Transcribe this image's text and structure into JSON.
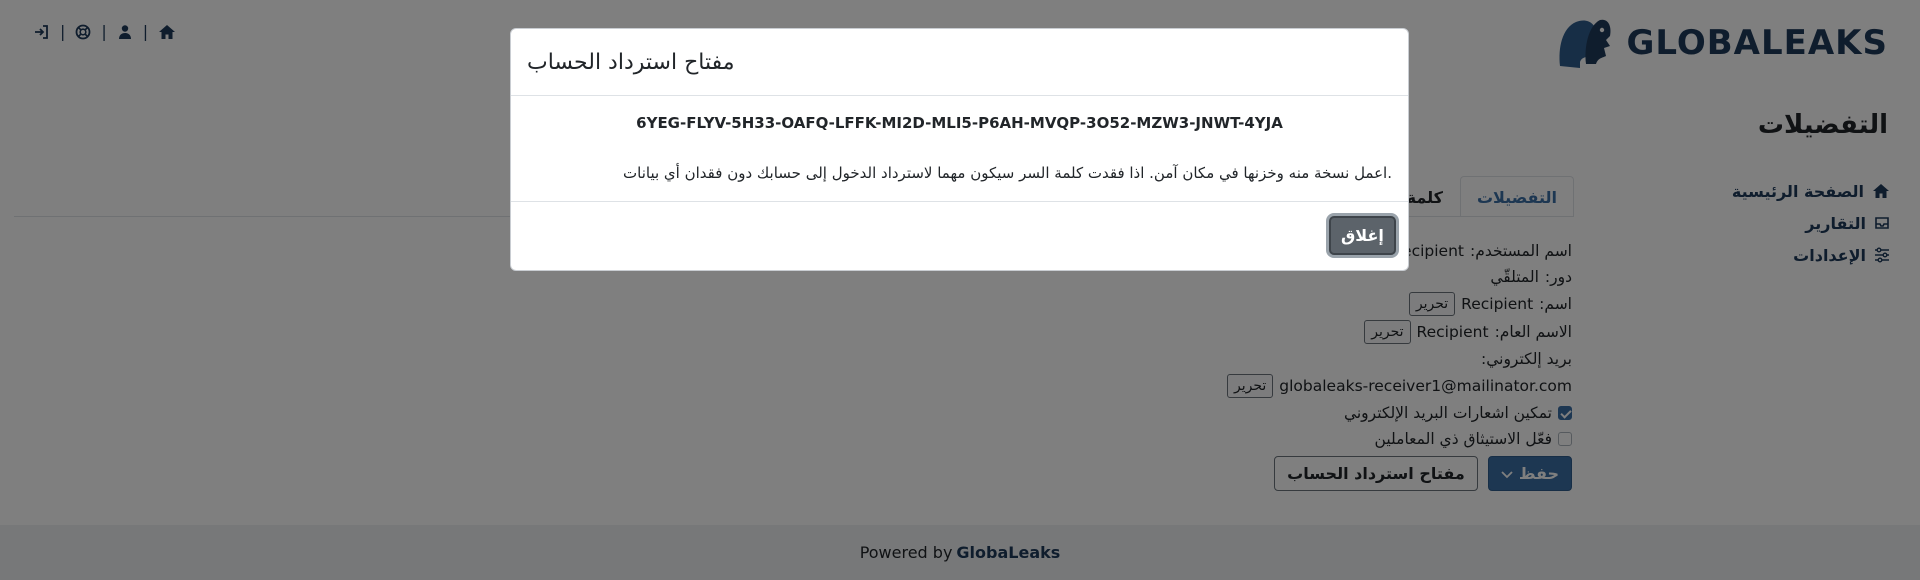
{
  "brand": {
    "name": "GLOBALEAKS"
  },
  "page": {
    "title": "التفضيلات"
  },
  "nav": [
    {
      "label": "الصفحة الرئيسية",
      "icon": "home-icon"
    },
    {
      "label": "التقارير",
      "icon": "inbox-icon"
    },
    {
      "label": "الإعدادات",
      "icon": "sliders-icon"
    }
  ],
  "tabs": [
    {
      "label": "التفضيلات",
      "active": true
    },
    {
      "label": "كلمة ا",
      "active": false
    }
  ],
  "details": {
    "username_label": "اسم المستخدم:",
    "username_value": "Recipient",
    "role_label": "دور:",
    "role_value": "المتلقّي",
    "name_label": "اسم:",
    "name_value": "Recipient",
    "public_name_label": "الاسم العام:",
    "public_name_value": "Recipient",
    "email_label": "بريد إلكتروني:",
    "email_value": "globaleaks-receiver1@mailinator.com",
    "edit_label": "تحرير",
    "email_notifications_label": "تمكين اشعارات البريد الإلكتروني",
    "email_notifications_checked": true,
    "two_factor_label": "فعّل الاستيثاق ذي المعاملين",
    "two_factor_checked": false
  },
  "actions": {
    "save_label": "حفظ",
    "recovery_key_label": "مفتاح استرداد الحساب"
  },
  "footer": {
    "prefix": "Powered by",
    "brand": "GlobaLeaks"
  },
  "modal": {
    "title": "مفتاح استرداد الحساب",
    "key": "6YEG-FLYV-5H33-OAFQ-LFFK-MI2D-MLI5-P6AH-MVQP-3O52-MZW3-JNWT-4YJA",
    "note": ".اعمل نسخة منه وخزنها في مكان آمن. اذا فقدت كلمة السر سيكون مهما لاسترداد الدخول إلى حسابك دون فقدان أي بيانات",
    "close_label": "إغلاق"
  },
  "colors": {
    "primary": "#3a6ea5",
    "brand_dark": "#1f3a5b",
    "backdrop": "rgba(0,0,0,0.5)"
  }
}
